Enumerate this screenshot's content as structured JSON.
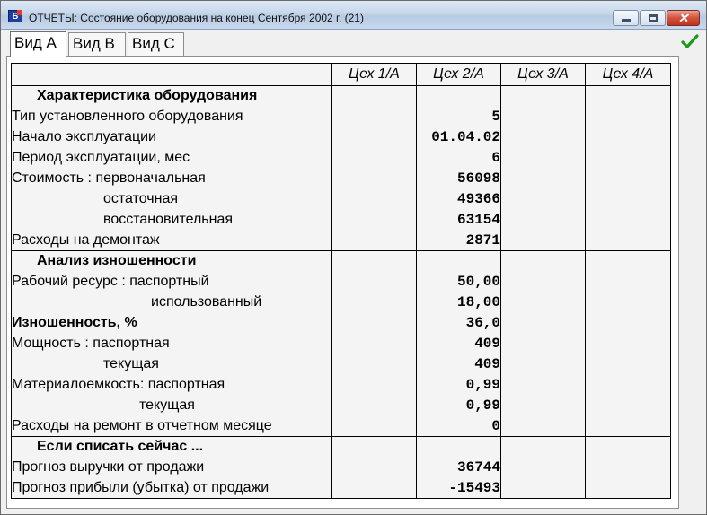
{
  "window": {
    "title": "ОТЧЕТЫ: Состояние оборудования на конец Сентября 2002 г. (21)",
    "icon": "app-icon",
    "buttons": {
      "minimize": "minimize-icon",
      "maximize": "maximize-icon",
      "close": "✕"
    }
  },
  "tabs": [
    {
      "label": "Вид А",
      "active": true
    },
    {
      "label": "Вид В",
      "active": false
    },
    {
      "label": "Вид С",
      "active": false
    }
  ],
  "toolbar": {
    "confirm_icon": "check-icon",
    "confirm_color": "#1a9a1a"
  },
  "grid": {
    "columns": [
      "",
      "Цех 1/А",
      "Цех 2/А",
      "Цех 3/А",
      "Цех 4/А"
    ],
    "colors": {
      "section": "#7a1010",
      "header": "#1a8a8a"
    },
    "sections": [
      {
        "title": "Характеристика оборудования",
        "rows": [
          {
            "label": "Тип установленного оборудования",
            "values": [
              "",
              "5",
              "",
              ""
            ]
          },
          {
            "label": "Начало эксплуатации",
            "values": [
              "",
              "01.04.02",
              "",
              ""
            ]
          },
          {
            "label": "Период эксплуатации, мес",
            "values": [
              "",
              "6",
              "",
              ""
            ]
          },
          {
            "label": "Стоимость : первоначальная",
            "values": [
              "",
              "56098",
              "",
              ""
            ]
          },
          {
            "label": "остаточная",
            "values": [
              "",
              "49366",
              "",
              ""
            ]
          },
          {
            "label": "восстановительная",
            "values": [
              "",
              "63154",
              "",
              ""
            ]
          },
          {
            "label": "Расходы на демонтаж",
            "values": [
              "",
              "2871",
              "",
              ""
            ]
          }
        ]
      },
      {
        "title": "Анализ изношенности",
        "rows": [
          {
            "label": "Рабочий ресурс : паспортный",
            "values": [
              "",
              "50,00",
              "",
              ""
            ]
          },
          {
            "label": "использованный",
            "values": [
              "",
              "18,00",
              "",
              ""
            ]
          },
          {
            "label": "Изношенность, %",
            "values": [
              "",
              "36,0",
              "",
              ""
            ]
          },
          {
            "label": "Мощность : паспортная",
            "values": [
              "",
              "409",
              "",
              ""
            ]
          },
          {
            "label": "текущая",
            "values": [
              "",
              "409",
              "",
              ""
            ]
          },
          {
            "label": "Материалоемкость: паспортная",
            "values": [
              "",
              "0,99",
              "",
              ""
            ]
          },
          {
            "label": "текущая",
            "values": [
              "",
              "0,99",
              "",
              ""
            ]
          },
          {
            "label": "Расходы на ремонт в отчетном месяце",
            "values": [
              "",
              "0",
              "",
              ""
            ]
          }
        ]
      },
      {
        "title": "Если списать сейчас ...",
        "rows": [
          {
            "label": "Прогноз выручки от продажи",
            "values": [
              "",
              "36744",
              "",
              ""
            ]
          },
          {
            "label": "Прогноз прибыли (убытка) от продажи",
            "values": [
              "",
              "-15493",
              "",
              ""
            ]
          }
        ]
      }
    ]
  }
}
